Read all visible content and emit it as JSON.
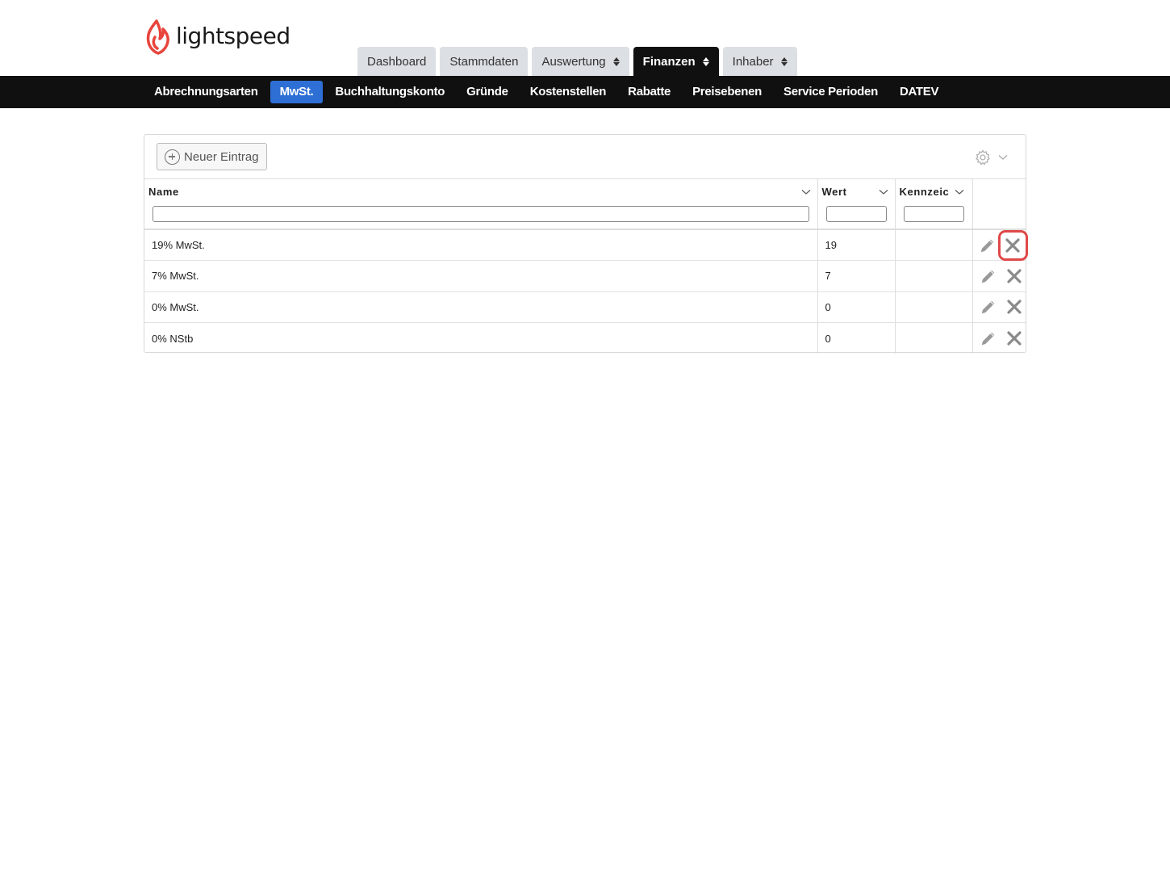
{
  "brand": {
    "name": "lightspeed",
    "logo_color": "#e8453c"
  },
  "main_tabs": [
    {
      "label": "Dashboard",
      "has_sort": false,
      "active": false
    },
    {
      "label": "Stammdaten",
      "has_sort": false,
      "active": false
    },
    {
      "label": "Auswertung",
      "has_sort": true,
      "active": false
    },
    {
      "label": "Finanzen",
      "has_sort": true,
      "active": true
    },
    {
      "label": "Inhaber",
      "has_sort": true,
      "active": false
    }
  ],
  "subnav": [
    {
      "label": "Abrechnungsarten",
      "active": false
    },
    {
      "label": "MwSt.",
      "active": true
    },
    {
      "label": "Buchhaltungskonto",
      "active": false
    },
    {
      "label": "Gründe",
      "active": false
    },
    {
      "label": "Kostenstellen",
      "active": false
    },
    {
      "label": "Rabatte",
      "active": false
    },
    {
      "label": "Preisebenen",
      "active": false
    },
    {
      "label": "Service Perioden",
      "active": false
    },
    {
      "label": "DATEV",
      "active": false
    }
  ],
  "toolbar": {
    "new_label": "Neuer Eintrag",
    "settings_icon": "gear-icon"
  },
  "table": {
    "columns": [
      "Name",
      "Wert",
      "Kennzeic"
    ],
    "rows": [
      {
        "name": "19% MwSt.",
        "wert": "19",
        "kennzeichen": ""
      },
      {
        "name": "7% MwSt.",
        "wert": "7",
        "kennzeichen": ""
      },
      {
        "name": "0% MwSt.",
        "wert": "0",
        "kennzeichen": ""
      },
      {
        "name": "0% NStb",
        "wert": "0",
        "kennzeichen": ""
      }
    ]
  },
  "colors": {
    "accent": "#2e6fd6",
    "nav_bg": "#101010",
    "highlight": "#e04848"
  }
}
